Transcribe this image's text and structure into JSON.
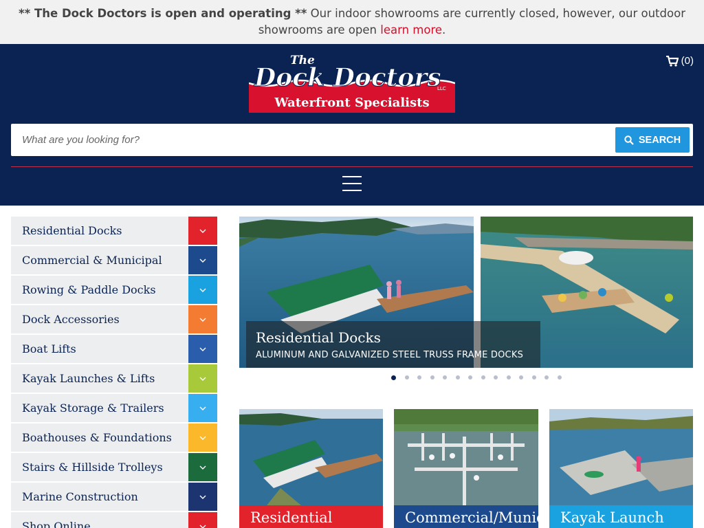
{
  "notice": {
    "bold_text": "** The Dock Doctors is open and operating **",
    "text": " Our indoor showrooms are currently closed, however, our outdoor showrooms are open ",
    "link": "learn more",
    "end": "."
  },
  "header": {
    "cart_count": "(0)",
    "logo": {
      "line1": "The",
      "line2": "Dock Doctors",
      "line3": "LLC",
      "tagline": "Waterfront Specialists"
    },
    "search_placeholder": "What are you looking for?",
    "search_button": "SEARCH"
  },
  "sidebar": {
    "items": [
      {
        "label": "Residential Docks",
        "color": "#e3232c"
      },
      {
        "label": "Commercial & Municipal",
        "color": "#1d4a8c"
      },
      {
        "label": "Rowing & Paddle Docks",
        "color": "#1aa2e0"
      },
      {
        "label": "Dock Accessories",
        "color": "#f47c32"
      },
      {
        "label": "Boat Lifts",
        "color": "#2a5dab"
      },
      {
        "label": "Kayak Launches & Lifts",
        "color": "#a8c93a"
      },
      {
        "label": "Kayak Storage & Trailers",
        "color": "#37aef0"
      },
      {
        "label": "Boathouses & Foundations",
        "color": "#fbb82b"
      },
      {
        "label": "Stairs & Hillside Trolleys",
        "color": "#1b6b3c"
      },
      {
        "label": "Marine Construction",
        "color": "#1c3470"
      },
      {
        "label": "Shop Online",
        "color": "#e3232c"
      }
    ]
  },
  "hero": {
    "title": "Residential Docks",
    "subtitle": "ALUMINUM AND GALVANIZED STEEL TRUSS FRAME DOCKS",
    "slide_count": 14,
    "active_slide": 1
  },
  "tiles": [
    {
      "label": "Residential",
      "color": "#e3232c"
    },
    {
      "label": "Commercial/Municipal",
      "color": "#1d4a8c"
    },
    {
      "label": "Kayak Launch",
      "color": "#1aa2e0"
    }
  ],
  "colors": {
    "navy": "#0a2352",
    "red": "#d0112b",
    "blue": "#1f96dd"
  }
}
